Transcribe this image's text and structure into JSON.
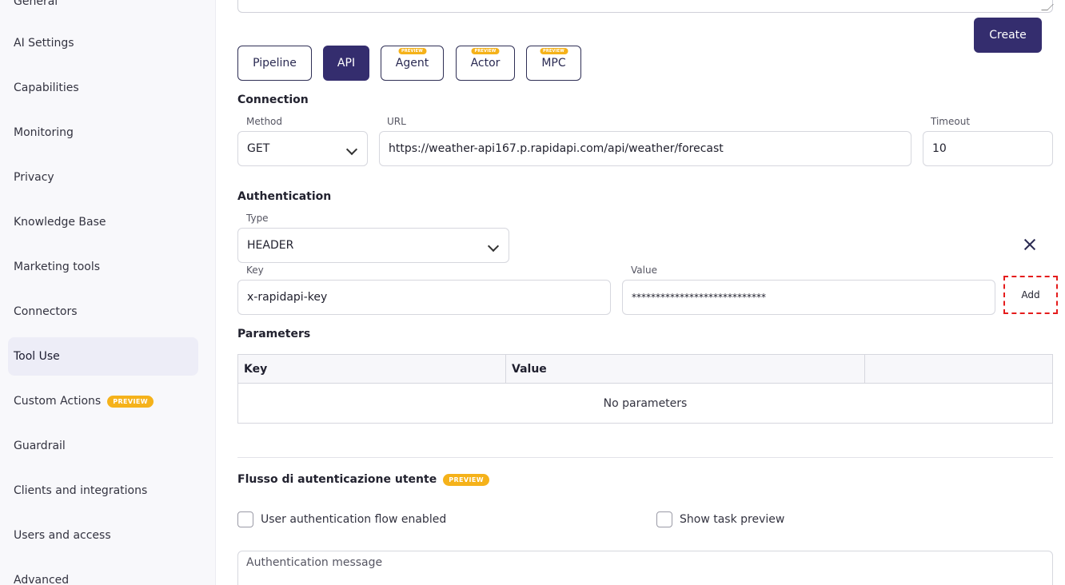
{
  "sidebar": {
    "items": [
      {
        "label": "General"
      },
      {
        "label": "AI Settings"
      },
      {
        "label": "Capabilities"
      },
      {
        "label": "Monitoring"
      },
      {
        "label": "Privacy"
      },
      {
        "label": "Knowledge Base"
      },
      {
        "label": "Marketing tools"
      },
      {
        "label": "Connectors"
      },
      {
        "label": "Tool Use",
        "active": true
      },
      {
        "label": "Custom Actions",
        "badge": "PREVIEW"
      },
      {
        "label": "Guardrail"
      },
      {
        "label": "Clients and integrations"
      },
      {
        "label": "Users and access"
      },
      {
        "label": "Advanced"
      }
    ]
  },
  "toolbar": {
    "create_label": "Create"
  },
  "tool_types": [
    {
      "label": "Pipeline"
    },
    {
      "label": "API",
      "selected": true
    },
    {
      "label": "Agent",
      "badge": "PREVIEW"
    },
    {
      "label": "Actor",
      "badge": "PREVIEW"
    },
    {
      "label": "MPC",
      "badge": "PREVIEW"
    }
  ],
  "connection": {
    "title": "Connection",
    "method_label": "Method",
    "method_value": "GET",
    "url_label": "URL",
    "url_value": "https://weather-api167.p.rapidapi.com/api/weather/forecast",
    "timeout_label": "Timeout",
    "timeout_value": "10"
  },
  "authentication": {
    "title": "Authentication",
    "type_label": "Type",
    "type_value": "HEADER",
    "key_label": "Key",
    "key_value": "x-rapidapi-key",
    "value_label": "Value",
    "value_value": "****************************",
    "add_label": "Add"
  },
  "parameters": {
    "title": "Parameters",
    "col_key": "Key",
    "col_value": "Value",
    "empty_text": "No parameters"
  },
  "user_auth": {
    "title": "Flusso di autenticazione utente",
    "badge": "PREVIEW",
    "flow_enabled_label": "User authentication flow enabled",
    "show_preview_label": "Show task preview",
    "message_placeholder": "Authentication message"
  },
  "colors": {
    "accent": "#342d6e",
    "badge": "#f5b21a",
    "highlight": "#e51c1c"
  }
}
